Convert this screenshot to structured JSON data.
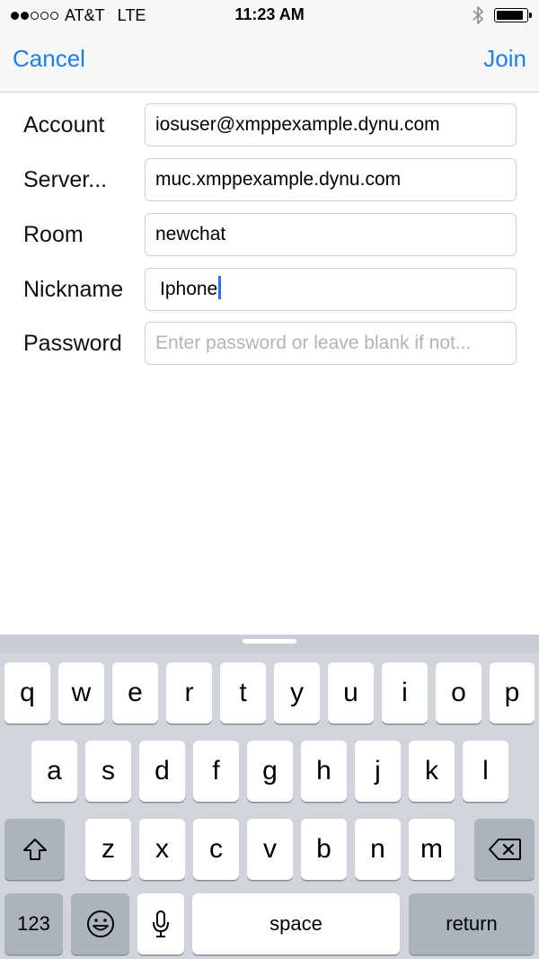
{
  "status_bar": {
    "carrier": "AT&T",
    "network": "LTE",
    "time": "11:23 AM",
    "signal_bars_filled": 2,
    "signal_bars_total": 5
  },
  "nav": {
    "cancel_label": "Cancel",
    "join_label": "Join",
    "accent_color": "#1a7ef5"
  },
  "form": {
    "account": {
      "label": "Account",
      "value": "iosuser@xmppexample.dynu.com"
    },
    "server": {
      "label": "Server...",
      "value": "muc.xmppexample.dynu.com"
    },
    "room": {
      "label": "Room",
      "value": "newchat"
    },
    "nickname": {
      "label": "Nickname",
      "value": "Iphone"
    },
    "password": {
      "label": "Password",
      "placeholder": "Enter password or leave blank if not..."
    }
  },
  "keyboard": {
    "row1": [
      "q",
      "w",
      "e",
      "r",
      "t",
      "y",
      "u",
      "i",
      "o",
      "p"
    ],
    "row2": [
      "a",
      "s",
      "d",
      "f",
      "g",
      "h",
      "j",
      "k",
      "l"
    ],
    "row3": [
      "z",
      "x",
      "c",
      "v",
      "b",
      "n",
      "m"
    ],
    "numbers_label": "123",
    "space_label": "space",
    "return_label": "return"
  }
}
